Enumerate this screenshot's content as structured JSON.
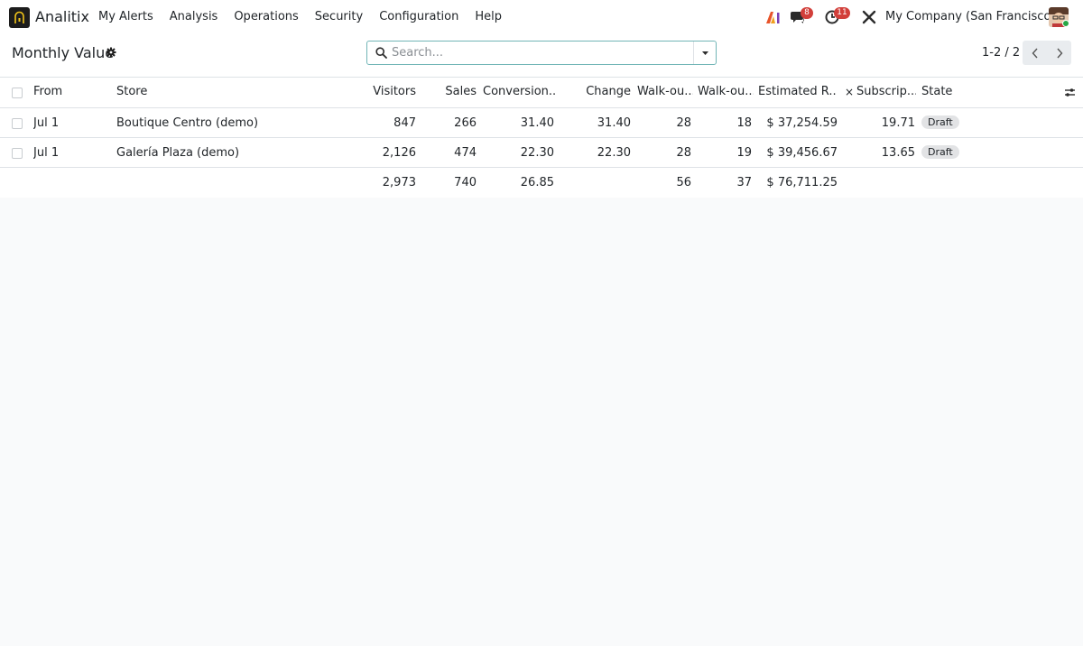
{
  "app": {
    "name": "Analitix",
    "company": "My Company (San Francisco)",
    "chat_count": "8",
    "activity_count": "11"
  },
  "menu": [
    "My Alerts",
    "Analysis",
    "Operations",
    "Security",
    "Configuration",
    "Help"
  ],
  "page": {
    "title": "Monthly Value"
  },
  "search": {
    "placeholder": "Search..."
  },
  "pager": {
    "value": "1-2 / 2"
  },
  "table": {
    "columns": [
      "From",
      "Store",
      "Visitors",
      "Sales",
      "Conversion...",
      "Change",
      "Walk-ou...",
      "Walk-ou...",
      "Estimated R...",
      "Subscrip...",
      "State"
    ],
    "rows": [
      {
        "from": "Jul 1",
        "store": "Boutique Centro (demo)",
        "visitors": "847",
        "sales": "266",
        "conversion": "31.40",
        "change": "31.40",
        "walkout1": "28",
        "walkout2": "18",
        "estimated": "$ 37,254.59",
        "subscription": "19.71",
        "state": "Draft"
      },
      {
        "from": "Jul 1",
        "store": "Galería Plaza (demo)",
        "visitors": "2,126",
        "sales": "474",
        "conversion": "22.30",
        "change": "22.30",
        "walkout1": "28",
        "walkout2": "19",
        "estimated": "$ 39,456.67",
        "subscription": "13.65",
        "state": "Draft"
      }
    ],
    "totals": {
      "visitors": "2,973",
      "sales": "740",
      "conversion": "26.85",
      "walkout1": "56",
      "walkout2": "37",
      "estimated": "$ 76,711.25"
    }
  },
  "colors": {
    "accent": "#71b5b6",
    "badge_red": "#d23f3a",
    "draft_badge": "#e2e3e5"
  }
}
